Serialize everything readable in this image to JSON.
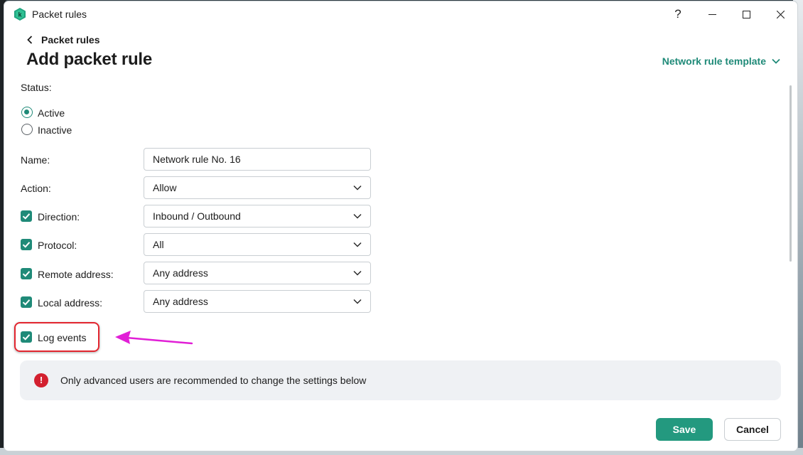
{
  "window": {
    "title": "Packet rules",
    "help_icon": "question-icon",
    "controls": [
      "minimize-icon",
      "maximize-icon",
      "close-icon"
    ]
  },
  "header": {
    "back_label": "Packet rules",
    "title": "Add packet rule",
    "template_link": "Network rule template"
  },
  "form": {
    "status_label": "Status:",
    "status_options": [
      {
        "label": "Active",
        "selected": true
      },
      {
        "label": "Inactive",
        "selected": false
      }
    ],
    "name_label": "Name:",
    "name_value": "Network rule No. 16",
    "action_label": "Action:",
    "action_value": "Allow",
    "direction_label": "Direction:",
    "direction_value": "Inbound / Outbound",
    "direction_checked": true,
    "protocol_label": "Protocol:",
    "protocol_value": "All",
    "protocol_checked": true,
    "remote_label": "Remote address:",
    "remote_value": "Any address",
    "remote_checked": true,
    "local_label": "Local address:",
    "local_value": "Any address",
    "local_checked": true,
    "log_label": "Log events",
    "log_checked": true
  },
  "notice": {
    "icon": "exclamation-icon",
    "text": "Only advanced users are recommended to change the settings below"
  },
  "footer": {
    "save_label": "Save",
    "cancel_label": "Cancel"
  },
  "colors": {
    "accent": "#1f8a78",
    "save_button": "#23997f",
    "alert": "#d3202f",
    "annotation_box": "#e2252f",
    "annotation_arrow": "#e11fd6"
  }
}
